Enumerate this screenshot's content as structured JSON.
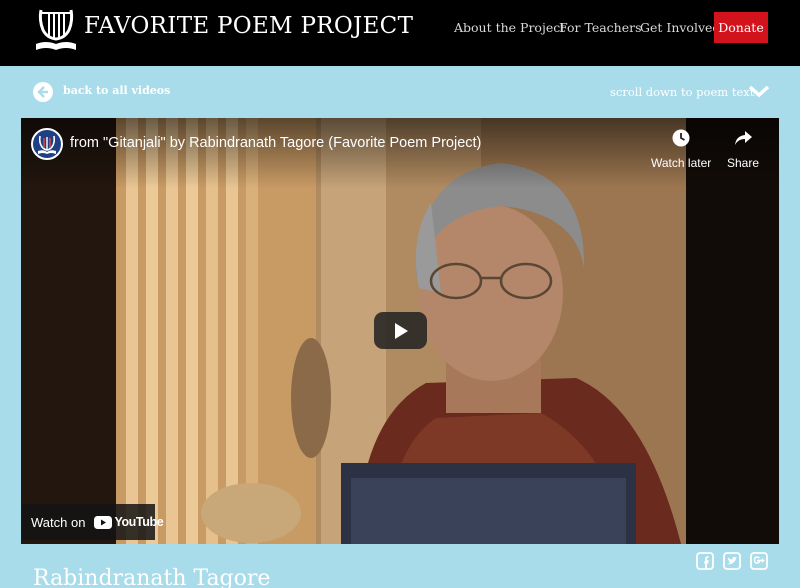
{
  "header": {
    "site_title": "FAVORITE POEM PROJECT",
    "logo_icon": "lyre-book-icon",
    "nav": [
      "About the Project",
      "For Teachers",
      "Get Involved"
    ],
    "donate_label": "Donate"
  },
  "subnav": {
    "back_label": "back to all videos",
    "back_icon": "arrow-left-icon",
    "scroll_label": "scroll down to poem text",
    "scroll_icon": "chevron-down-icon"
  },
  "video": {
    "title": "from \"Gitanjali\" by Rabindranath Tagore (Favorite Poem Project)",
    "actions": [
      {
        "label": "Watch later",
        "icon": "clock-icon"
      },
      {
        "label": "Share",
        "icon": "share-arrow-icon"
      }
    ],
    "watch_on_label": "Watch on",
    "youtube_label": "YouTube"
  },
  "social": {
    "icons": [
      "facebook-icon",
      "twitter-icon",
      "google-plus-icon"
    ]
  },
  "poet": {
    "name": "Rabindranath Tagore"
  },
  "colors": {
    "page_background": "#a9dceb",
    "header_background": "#000000",
    "donate_background": "#d2131c",
    "text_light": "#ffffff"
  }
}
